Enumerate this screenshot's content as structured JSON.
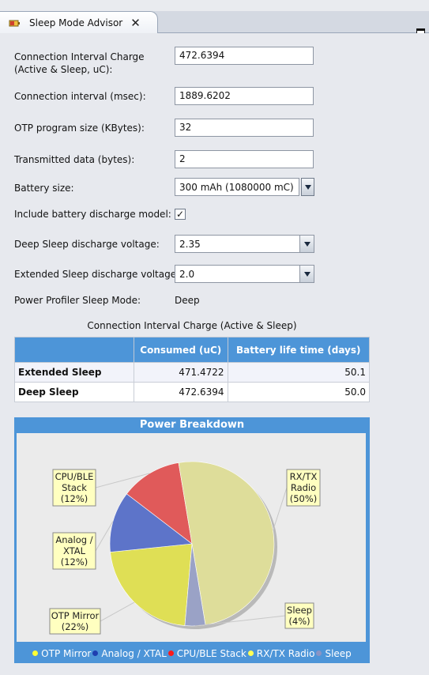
{
  "tab": {
    "title": "Sleep Mode Advisor"
  },
  "form": {
    "conn_charge_label_1": "Connection Interval Charge",
    "conn_charge_label_2": "(Active & Sleep, uC):",
    "conn_charge_value": "472.6394",
    "conn_interval_label": "Connection interval (msec):",
    "conn_interval_value": "1889.6202",
    "otp_label": "OTP program size (KBytes):",
    "otp_value": "32",
    "tx_label": "Transmitted data (bytes):",
    "tx_value": "2",
    "battery_label": "Battery size:",
    "battery_value": "300 mAh (1080000 mC)",
    "discharge_label": "Include battery discharge model:",
    "discharge_checked": "✓",
    "deep_voltage_label": "Deep Sleep discharge voltage:",
    "deep_voltage_value": "2.35",
    "ext_voltage_label": "Extended Sleep discharge voltage:",
    "ext_voltage_value": "2.0",
    "profiler_label": "Power Profiler Sleep Mode:",
    "profiler_value": "Deep"
  },
  "table": {
    "title": "Connection Interval Charge (Active & Sleep)",
    "headers": [
      "",
      "Consumed (uC)",
      "Battery life time (days)"
    ],
    "rows": [
      [
        "Extended Sleep",
        "471.4722",
        "50.1"
      ],
      [
        "Deep Sleep",
        "472.6394",
        "50.0"
      ]
    ]
  },
  "chart_data": {
    "type": "pie",
    "title": "Power Breakdown",
    "slices": [
      {
        "name": "OTP Mirror",
        "value": 22,
        "label": [
          "OTP Mirror",
          "(22%)"
        ],
        "color": "#dfdf55"
      },
      {
        "name": "Analog / XTAL",
        "value": 12,
        "label": [
          "Analog /",
          "XTAL",
          "(12%)"
        ],
        "color": "#5d74c9"
      },
      {
        "name": "CPU/BLE Stack",
        "value": 12,
        "label": [
          "CPU/BLE",
          "Stack",
          "(12%)"
        ],
        "color": "#e05a5a"
      },
      {
        "name": "RX/TX Radio",
        "value": 50,
        "label": [
          "RX/TX",
          "Radio",
          "(50%)"
        ],
        "color": "#dedd9a"
      },
      {
        "name": "Sleep",
        "value": 4,
        "label": [
          "Sleep",
          "(4%)"
        ],
        "color": "#9aa2c6"
      }
    ],
    "legend": [
      {
        "name": "OTP Mirror",
        "color": "#ffff33"
      },
      {
        "name": "Analog / XTAL",
        "color": "#1f3fb0"
      },
      {
        "name": "CPU/BLE Stack",
        "color": "#ff1a1a"
      },
      {
        "name": "RX/TX Radio",
        "color": "#ffff55"
      },
      {
        "name": "Sleep",
        "color": "#8a94c4"
      }
    ],
    "legend_position": "bottom"
  }
}
